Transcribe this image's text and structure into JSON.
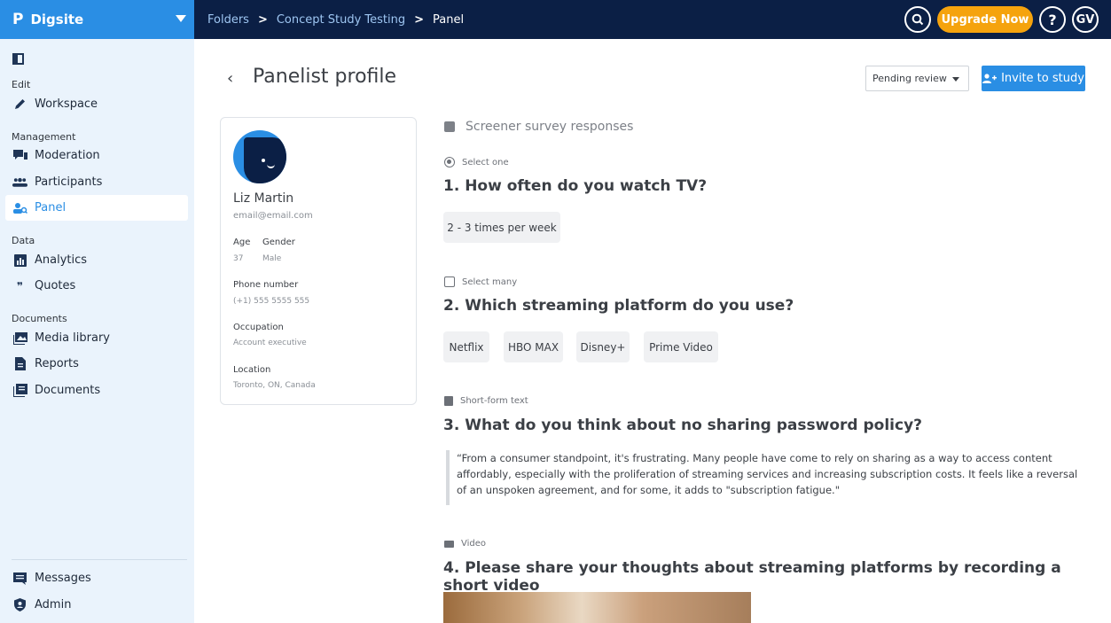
{
  "brand": {
    "name": "Digsite",
    "logo_glyph": "P"
  },
  "breadcrumb": {
    "items": [
      "Folders",
      "Concept Study Testing",
      "Panel"
    ],
    "separator": ">"
  },
  "topbar": {
    "upgrade_label": "Upgrade Now",
    "help_glyph": "?",
    "user_initials": "GV",
    "search_icon": "search-icon"
  },
  "sidebar": {
    "sections": [
      "Edit",
      "Management",
      "Data",
      "Documents"
    ],
    "items": [
      {
        "label": "Workspace",
        "icon": "pencil-icon"
      },
      {
        "label": "Moderation",
        "icon": "chat-icon"
      },
      {
        "label": "Participants",
        "icon": "people-icon"
      },
      {
        "label": "Panel",
        "icon": "panel-search-icon",
        "active": true
      },
      {
        "label": "Analytics",
        "icon": "bar-chart-icon"
      },
      {
        "label": "Quotes",
        "icon": "quote-icon"
      },
      {
        "label": "Media library",
        "icon": "image-icon"
      },
      {
        "label": "Reports",
        "icon": "report-icon"
      },
      {
        "label": "Documents",
        "icon": "documents-icon"
      },
      {
        "label": "Messages",
        "icon": "message-icon"
      },
      {
        "label": "Admin",
        "icon": "shield-icon"
      }
    ]
  },
  "page": {
    "title": "Panelist profile",
    "status_select": "Pending review",
    "invite_label": "Invite to study"
  },
  "profile": {
    "name": "Liz Martin",
    "email": "email@email.com",
    "age_label": "Age",
    "age": "37",
    "gender_label": "Gender",
    "gender": "Male",
    "phone_label": "Phone number",
    "phone": "(+1) 555 5555 555",
    "occupation_label": "Occupation",
    "occupation": "Account executive",
    "location_label": "Location",
    "location": "Toronto, ON, Canada"
  },
  "survey": {
    "header": "Screener survey responses",
    "questions": [
      {
        "type": "Select one",
        "title": "1. How often do you watch TV?",
        "answers": [
          "2 - 3 times per week"
        ]
      },
      {
        "type": "Select many",
        "title": "2. Which streaming platform do you use?",
        "answers": [
          "Netflix",
          "HBO MAX",
          "Disney+",
          "Prime Video"
        ]
      },
      {
        "type": "Short-form text",
        "title": "3. What do you think about no sharing password policy?",
        "text": "“From a consumer standpoint, it's frustrating. Many people have come to rely on sharing as a way to access content affordably, especially with the proliferation of streaming services and increasing subscription costs. It feels like a reversal of an unspoken agreement, and for some, it adds to \"subscription fatigue.\""
      },
      {
        "type": "Video",
        "title": "4. Please share your thoughts about streaming platforms by recording a short video"
      }
    ]
  },
  "colors": {
    "accent": "#2a8ee4",
    "topbar": "#0b1f45",
    "upgrade": "#f5a30d",
    "sidebar": "#eaf3fc"
  }
}
